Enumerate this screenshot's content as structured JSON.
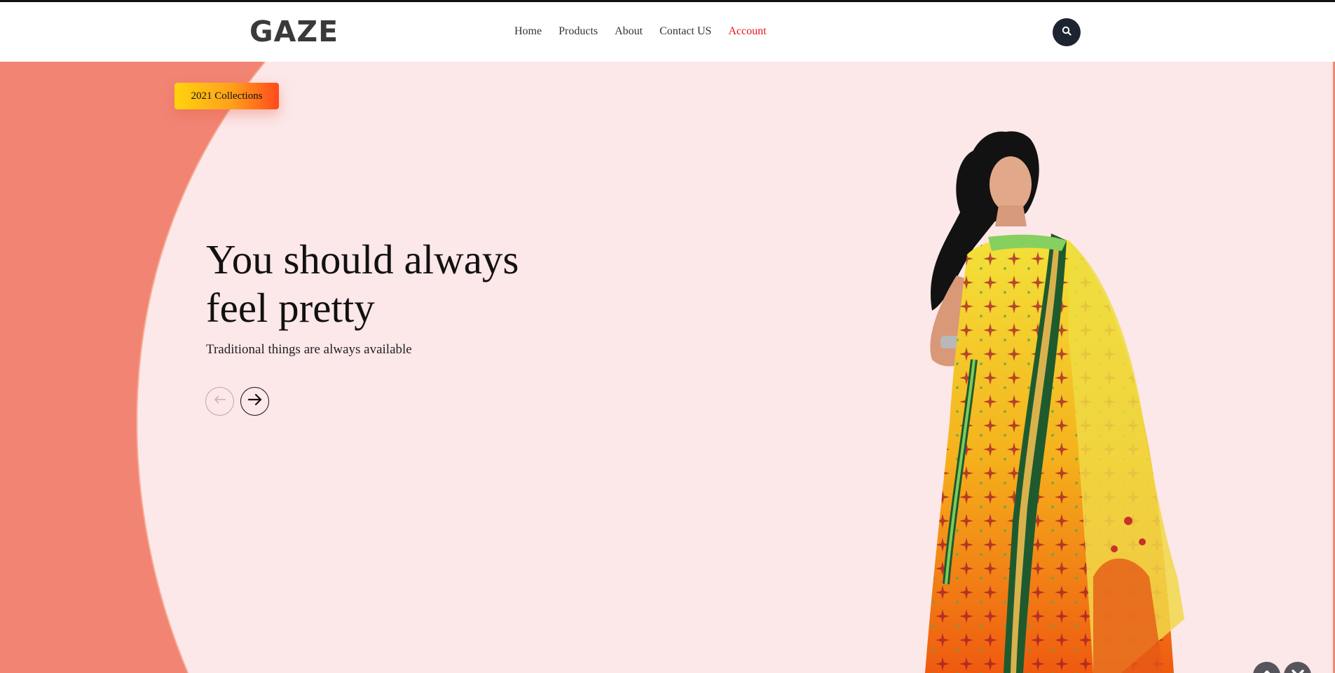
{
  "brand": {
    "logo_text": "GAZE"
  },
  "nav": {
    "items": [
      {
        "label": "Home"
      },
      {
        "label": "Products"
      },
      {
        "label": "About"
      },
      {
        "label": "Contact US"
      },
      {
        "label": "Account",
        "active": true
      }
    ],
    "search_icon": "search-icon"
  },
  "hero": {
    "badge": "2021 Collections",
    "headline_line1": "You should always",
    "headline_line2": "feel pretty",
    "subline": "Traditional things are always available",
    "prev_icon": "arrow-left-icon",
    "next_icon": "arrow-right-icon",
    "image_alt": "model in yellow saree"
  },
  "scroll_controls": {
    "up_icon": "chevron-up-icon",
    "down_icon": "chevron-down-icon"
  },
  "colors": {
    "hero_bg": "#fce7e9",
    "accent_shape": "#f28474",
    "nav_active": "#e8141b",
    "badge_gradient": [
      "#ffd30e",
      "#ff4a1c"
    ],
    "search_button": "#1d2330",
    "scroll_button": "#55555b"
  }
}
